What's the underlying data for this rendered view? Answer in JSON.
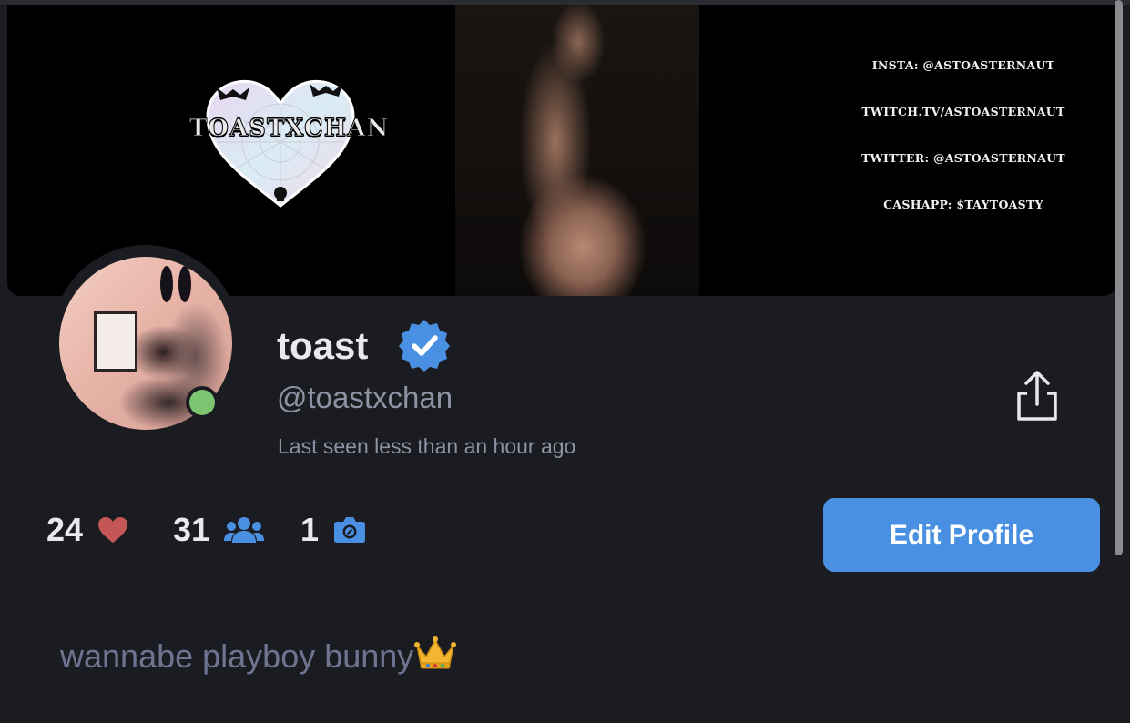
{
  "banner": {
    "logo_text": "TOASTXCHAN",
    "links": [
      "INSTA: @ASTOASTERNAUT",
      "TWITCH.TV/ASTOASTERNAUT",
      "TWITTER: @ASTOASTERNAUT",
      "CASHAPP: $TAYTOASTY"
    ]
  },
  "profile": {
    "display_name": "toast",
    "username": "@toastxchan",
    "last_seen": "Last seen less than an hour ago",
    "verified": true,
    "online": true
  },
  "stats": {
    "likes": "24",
    "followers": "31",
    "photos": "1"
  },
  "actions": {
    "edit_profile_label": "Edit Profile"
  },
  "bio": {
    "text": "wannabe playboy bunny",
    "emoji": "crown"
  },
  "icons": {
    "share": "share-icon",
    "verified": "verified-badge-icon",
    "heart": "heart-icon",
    "followers": "users-icon",
    "photos": "camera-icon"
  },
  "colors": {
    "background": "#1b1c21",
    "accent": "#4a90e2",
    "heart": "#c45656",
    "online": "#7dc571",
    "muted_text": "#8d93a3",
    "bio_text": "#6f7591"
  }
}
